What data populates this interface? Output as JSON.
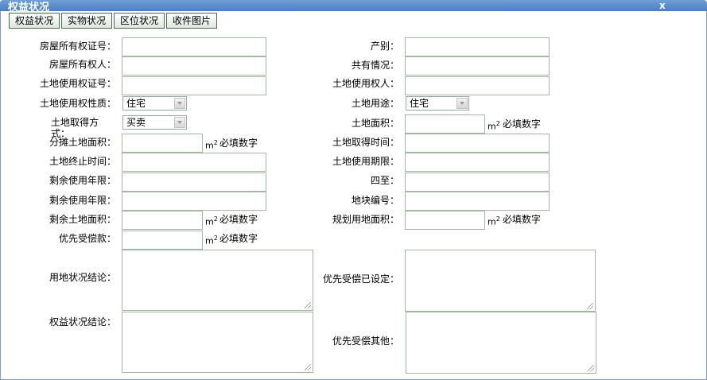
{
  "window": {
    "title": "权益状况",
    "close": "x"
  },
  "tabs": [
    "权益状况",
    "实物状况",
    "区位状况",
    "收件图片"
  ],
  "unit": "m",
  "unit_sup": "2",
  "required_note": "必填数字",
  "left": {
    "house_cert_no": "房屋所有权证号：",
    "house_owner": "房屋所有权人：",
    "land_cert_no": "土地使用权证号：",
    "land_use_nature": "土地使用权性质：",
    "land_use_nature_value": "住宅",
    "land_acquire_method": "土地取得方式：",
    "land_acquire_method_value": "买卖",
    "shared_land_area": "分摊土地面积：",
    "land_end_time": "土地终止时间：",
    "remaining_years_1": "剩余使用年限：",
    "remaining_years_2": "剩余使用年限：",
    "remaining_land_area": "剩余土地面积：",
    "priority_payment": "优先受偿款：",
    "land_conclusion": "用地状况结论：",
    "rights_conclusion": "权益状况结论："
  },
  "right": {
    "property_type": "产别：",
    "co_ownership": "共有情况：",
    "land_user": "土地使用权人：",
    "land_use": "土地用途：",
    "land_use_value": "住宅",
    "land_area": "土地面积：",
    "land_acquire_time": "土地取得时间：",
    "land_use_period": "土地使用期限：",
    "boundaries": "四至：",
    "parcel_no": "地块编号：",
    "planned_land_area": "规划用地面积：",
    "priority_set": "优先受偿已设定：",
    "priority_other": "优先受偿其他："
  }
}
